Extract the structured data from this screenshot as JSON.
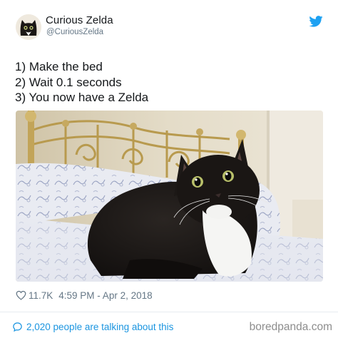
{
  "tweet": {
    "display_name": "Curious Zelda",
    "handle": "@CuriousZelda",
    "lines": [
      "1) Make the bed",
      "2) Wait 0.1 seconds",
      "3) You now have a Zelda"
    ],
    "likes": "11.7K",
    "timestamp": "4:59 PM - Apr 2, 2018",
    "talking": "2,020 people are talking about this"
  },
  "watermark": "boredpanda.com",
  "icons": {
    "brand": "twitter-bird-icon",
    "like": "heart-icon",
    "reply": "speech-bubble-icon"
  },
  "colors": {
    "twitter_blue": "#1da1f2",
    "link_blue": "#1b95e0",
    "muted_gray": "#657786",
    "text_black": "#14171a"
  }
}
